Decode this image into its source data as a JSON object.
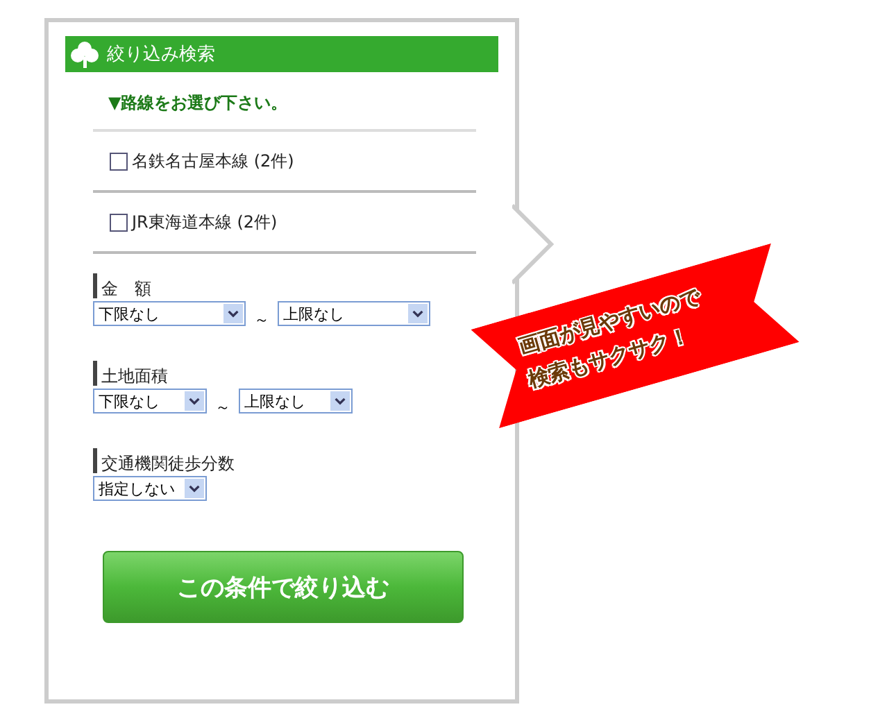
{
  "header": {
    "title": "絞り込み検索"
  },
  "route_section": {
    "heading": "▼路線をお選び下さい。",
    "routes": [
      {
        "label": "名鉄名古屋本線 (2件)",
        "checked": false
      },
      {
        "label": "JR東海道本線 (2件)",
        "checked": false
      }
    ]
  },
  "filters": [
    {
      "kind": "range",
      "label": "金　額",
      "min": "下限なし",
      "max": "上限なし",
      "separator": "～",
      "wide": true
    },
    {
      "kind": "range",
      "label": "土地面積",
      "min": "下限なし",
      "max": "上限なし",
      "separator": "～",
      "wide": false
    },
    {
      "kind": "single",
      "label": "交通機関徒歩分数",
      "value": "指定しない"
    }
  ],
  "submit_button": "この条件で絞り込む",
  "banner": {
    "lines": [
      "画面が見やすいので",
      "検索もサクサク！"
    ]
  }
}
